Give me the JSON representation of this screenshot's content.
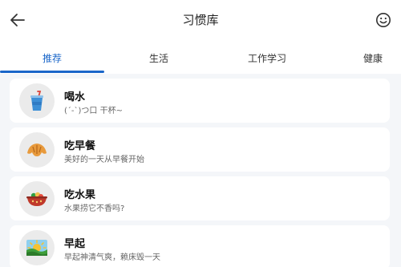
{
  "header": {
    "title": "习惯库",
    "back_icon": "arrow-left-icon",
    "right_icon": "smiley-face-icon"
  },
  "tabs": [
    {
      "label": "推荐",
      "active": true
    },
    {
      "label": "生活",
      "active": false
    },
    {
      "label": "工作学习",
      "active": false
    },
    {
      "label": "健康",
      "active": false
    }
  ],
  "habits": [
    {
      "name": "喝水",
      "desc": "(ˊ-ˋ)つ口 干杯~",
      "icon": "cup-with-straw-icon"
    },
    {
      "name": "吃早餐",
      "desc": "美好的一天从早餐开始",
      "icon": "croissant-icon"
    },
    {
      "name": "吃水果",
      "desc": "水果捞它不香吗?",
      "icon": "fruit-bowl-icon"
    },
    {
      "name": "早起",
      "desc": "早起神清气爽，赖床毁一天",
      "icon": "sunrise-icon"
    }
  ],
  "colors": {
    "accent": "#1a66c9",
    "background": "#f4f6f9",
    "card": "#ffffff"
  }
}
